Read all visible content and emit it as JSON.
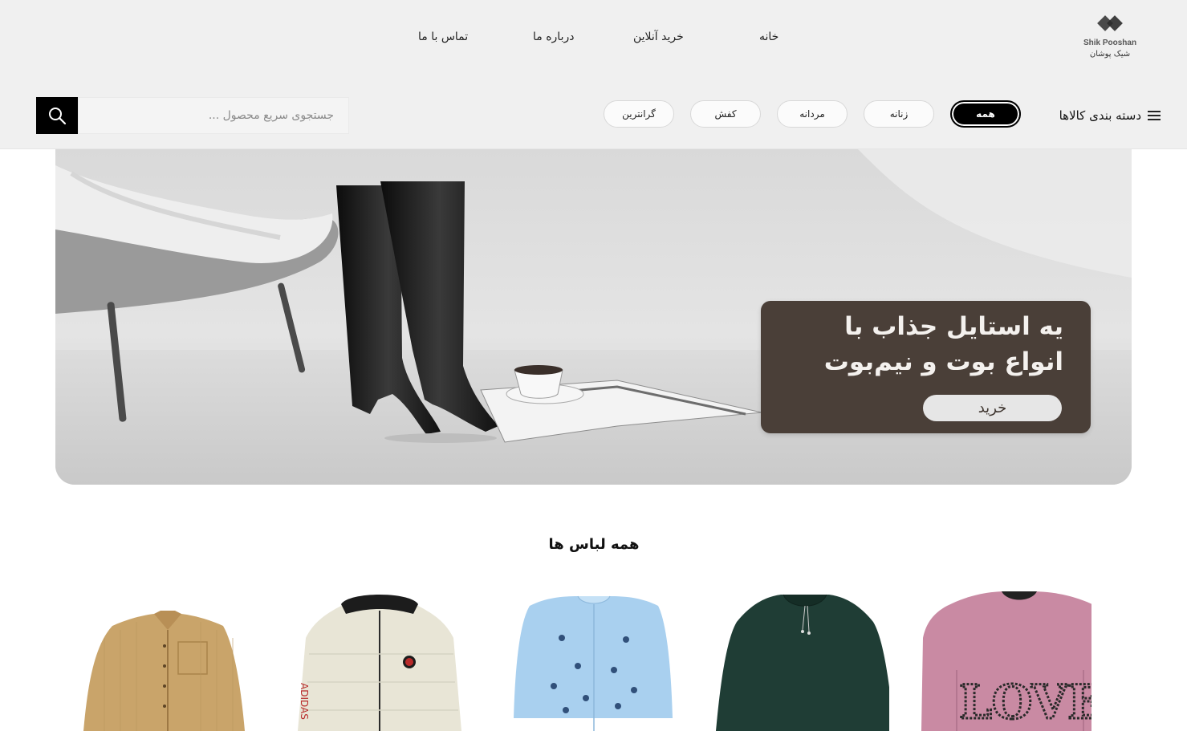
{
  "brand": {
    "name_en": "Shik Pooshan",
    "name_fa": "شیک پوشان",
    "logo_icon": "double-diamond-logo"
  },
  "nav": {
    "home": "خانه",
    "shop": "خرید آنلاین",
    "about": "درباره ما",
    "contact": "تماس با ما"
  },
  "categories": {
    "title": "دسته بندی کالاها",
    "menu_icon": "hamburger-icon",
    "pills": [
      "همه",
      "زنانه",
      "مردانه",
      "کفش",
      "گرانترین"
    ],
    "active_index": 0
  },
  "search": {
    "placeholder": "جستجوی سریع محصول ...",
    "value": "",
    "icon": "search-icon"
  },
  "hero": {
    "line1": "یه استایل جذاب با",
    "line2": "انواع بوت و نیم‌بوت",
    "button": "خرید",
    "promo_color": "#4a3f38"
  },
  "section": {
    "title": "همه لباس ها"
  },
  "products": [
    {
      "name": "pink-love-sweater",
      "color": "#c98aa3"
    },
    {
      "name": "dark-green-blouse",
      "color": "#1f3d35"
    },
    {
      "name": "light-blue-embroidered-shirt",
      "color": "#a9d0ef"
    },
    {
      "name": "cream-puffer-jacket",
      "color": "#e8e5d6"
    },
    {
      "name": "tan-corduroy-shirt",
      "color": "#c9a46a"
    }
  ],
  "colors": {
    "header_bg": "#f0f0f0",
    "accent": "#000000"
  }
}
